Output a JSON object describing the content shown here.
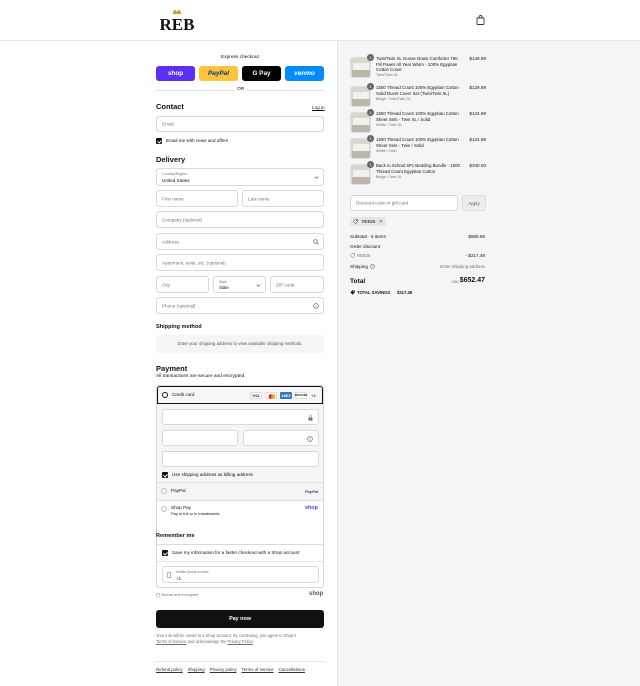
{
  "brand": {
    "logo_text": "REB"
  },
  "express": {
    "title": "Express checkout",
    "buttons": [
      {
        "label": "shop",
        "bg": "#5a31f4",
        "color": "#ffffff"
      },
      {
        "label": "PayPal",
        "bg": "#ffc439",
        "color": "#003087"
      },
      {
        "label": "G Pay",
        "bg": "#000000",
        "color": "#ffffff"
      },
      {
        "label": "venmo",
        "bg": "#008cff",
        "color": "#ffffff"
      }
    ],
    "or": "OR"
  },
  "contact": {
    "title": "Contact",
    "login": "Log in",
    "email_placeholder": "Email",
    "news_label": "Email me with news and offers"
  },
  "delivery": {
    "title": "Delivery",
    "country_label": "Country/Region",
    "country_value": "United States",
    "first_name": "First name",
    "last_name": "Last name",
    "company": "Company (optional)",
    "address": "Address",
    "apartment": "Apartment, suite, etc. (optional)",
    "city": "City",
    "state_label": "State",
    "state_value": "State",
    "zip": "ZIP code",
    "phone": "Phone (optional)"
  },
  "shipping_method": {
    "title": "Shipping method",
    "message": "Enter your shipping address to view available shipping methods."
  },
  "payment": {
    "title": "Payment",
    "subtitle": "All transactions are secure and encrypted.",
    "credit_card_label": "Credit card",
    "card_brands": [
      "VISA",
      "MC",
      "AMEX",
      "DISCOVER"
    ],
    "more_brands": "+4",
    "billing_label": "Use shipping address as billing address",
    "paypal_label": "PayPal",
    "paypal_logo": "PayPal",
    "shoppay_label": "Shop Pay",
    "shoppay_sub": "Pay in full or in installments",
    "shoppay_logo": "shop"
  },
  "remember": {
    "title": "Remember me",
    "save_label": "Save my information for a faster checkout with a Shop account",
    "phone_label": "Mobile phone number",
    "phone_value": "+1",
    "secure_text": "Secure and encrypted",
    "shop_logo": "shop"
  },
  "pay_now": "Pay now",
  "legal": {
    "line1": "Your info will be saved to a Shop account. By continuing, you agree to Shop's",
    "terms": "Terms of Service",
    "and": "and acknowledge the",
    "privacy": "Privacy Policy",
    "period": "."
  },
  "footer_links": [
    "Refund policy",
    "Shipping",
    "Privacy policy",
    "Terms of service",
    "Cancellations"
  ],
  "cart": {
    "items": [
      {
        "qty": "1",
        "name": "Twin/Twin XL Goose Down Comforter 750 Fill Power All Year Warm - 100% Egyptian Cotton Cover",
        "variant": "Twin/Twin XL",
        "price": "$149.99"
      },
      {
        "qty": "1",
        "name": "1500 Thread Count 100% Egyptian Cotton Solid Duvet Cover Set (Twin/Twin XL)",
        "variant": "Beige / Twin/Twin XL",
        "price": "$129.99"
      },
      {
        "qty": "1",
        "name": "1500 Thread Count 100% Egyptian Cotton Sheet Sets - Twin XL / Solid",
        "variant": "White / Twin XL",
        "price": "$124.99"
      },
      {
        "qty": "1",
        "name": "1500 Thread Count 100% Egyptian Cotton Sheet Sets - Twin / Solid",
        "variant": "White / Twin",
        "price": "$124.99"
      },
      {
        "qty": "1",
        "name": "Back to School 6Pc Bedding Bundle - 1500 Thread Count Egyptian Cotton",
        "variant": "Beige / Twin XL",
        "price": "$340.00"
      }
    ],
    "discount_placeholder": "Discount code or gift card",
    "apply": "Apply",
    "code_tag": "REB25",
    "subtotal_label": "Subtotal · 5 items",
    "subtotal_value": "$869.96",
    "order_discount_label": "Order discount",
    "order_discount_code": "REB25",
    "order_discount_value": "- $217.49",
    "shipping_label": "Shipping",
    "shipping_value": "Enter shipping address",
    "total_label": "Total",
    "currency": "USD",
    "total_value": "$652.47",
    "savings_label": "TOTAL SAVINGS",
    "savings_value": "$217.49"
  }
}
